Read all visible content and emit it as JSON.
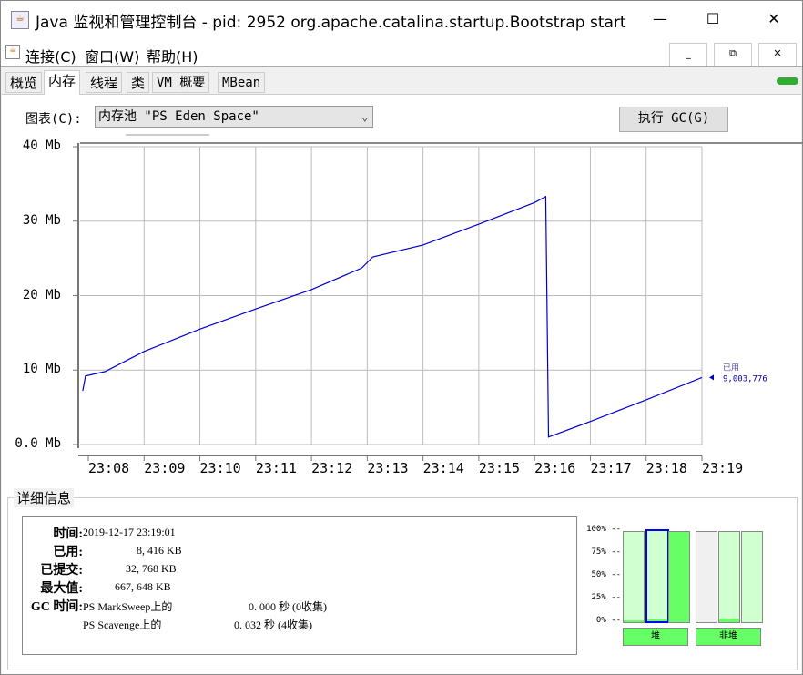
{
  "window": {
    "title": "Java 监视和管理控制台 - pid: 2952 org.apache.catalina.startup.Bootstrap start",
    "minimize": "—",
    "maximize": "☐",
    "close": "✕"
  },
  "menu": {
    "items": [
      "连接(C)",
      "窗口(W)",
      "帮助(H)"
    ],
    "inner_min": "_",
    "inner_restore": "⧉",
    "inner_close": "✕"
  },
  "tabs": [
    "概览",
    "内存",
    "线程",
    "类",
    "VM 概要",
    "MBean"
  ],
  "active_tab": 1,
  "chart_label": "图表(C):",
  "chart_select": "内存池 \"PS Eden Space\"",
  "gc_button": "执行 GC(G)",
  "chart_data": {
    "type": "line",
    "ylabel": "",
    "xlabel": "",
    "y_ticks": [
      "0.0 Mb",
      "10 Mb",
      "20 Mb",
      "30 Mb",
      "40 Mb"
    ],
    "ylim": [
      0,
      40
    ],
    "x_ticks": [
      "23:08",
      "23:09",
      "23:10",
      "23:11",
      "23:12",
      "23:13",
      "23:14",
      "23:15",
      "23:16",
      "23:17",
      "23:18",
      "23:19"
    ],
    "xlim_minutes_from_2308": [
      -0.1,
      11
    ],
    "series": [
      {
        "name": "已用",
        "color": "#0000cc",
        "x": [
          -0.1,
          -0.05,
          0.3,
          1,
          2,
          3,
          4,
          4.9,
          5.1,
          6,
          7,
          8,
          8.2,
          8.25,
          9,
          10,
          11
        ],
        "y": [
          7.2,
          9.2,
          9.8,
          12.5,
          15.5,
          18.2,
          20.8,
          23.7,
          25.2,
          26.8,
          29.6,
          32.5,
          33.3,
          1.0,
          3.1,
          6.0,
          9.0
        ]
      }
    ],
    "legend": {
      "label": "已用",
      "value": "9,003,776"
    }
  },
  "details": {
    "title": "详细信息",
    "time_label": "时间:",
    "time": "2019-12-17 23:19:01",
    "used_label": "已用:",
    "used": "8, 416 KB",
    "committed_label": "已提交:",
    "committed": "32, 768 KB",
    "max_label": "最大值:",
    "max": "667, 648 KB",
    "gc_label": "GC 时间:",
    "gc": [
      {
        "name": "PS MarkSweep上的",
        "value": "0. 000  秒 (0收集)"
      },
      {
        "name": "PS Scavenge上的",
        "value": "0. 032  秒 (4收集)"
      }
    ]
  },
  "pools": {
    "pct_labels": [
      "100% --",
      "75% --",
      "50% --",
      "25% --",
      "0% --"
    ],
    "heap_label": "堆",
    "nonheap_label": "非堆",
    "heap_fill": [
      0.02,
      0.02,
      1.0
    ],
    "nonheap_fill": [
      0,
      0.04,
      0
    ],
    "nonheap_bg": [
      "#f0f0f0",
      "#d0ffd0",
      "#d0ffd0"
    ],
    "selected": 1
  }
}
